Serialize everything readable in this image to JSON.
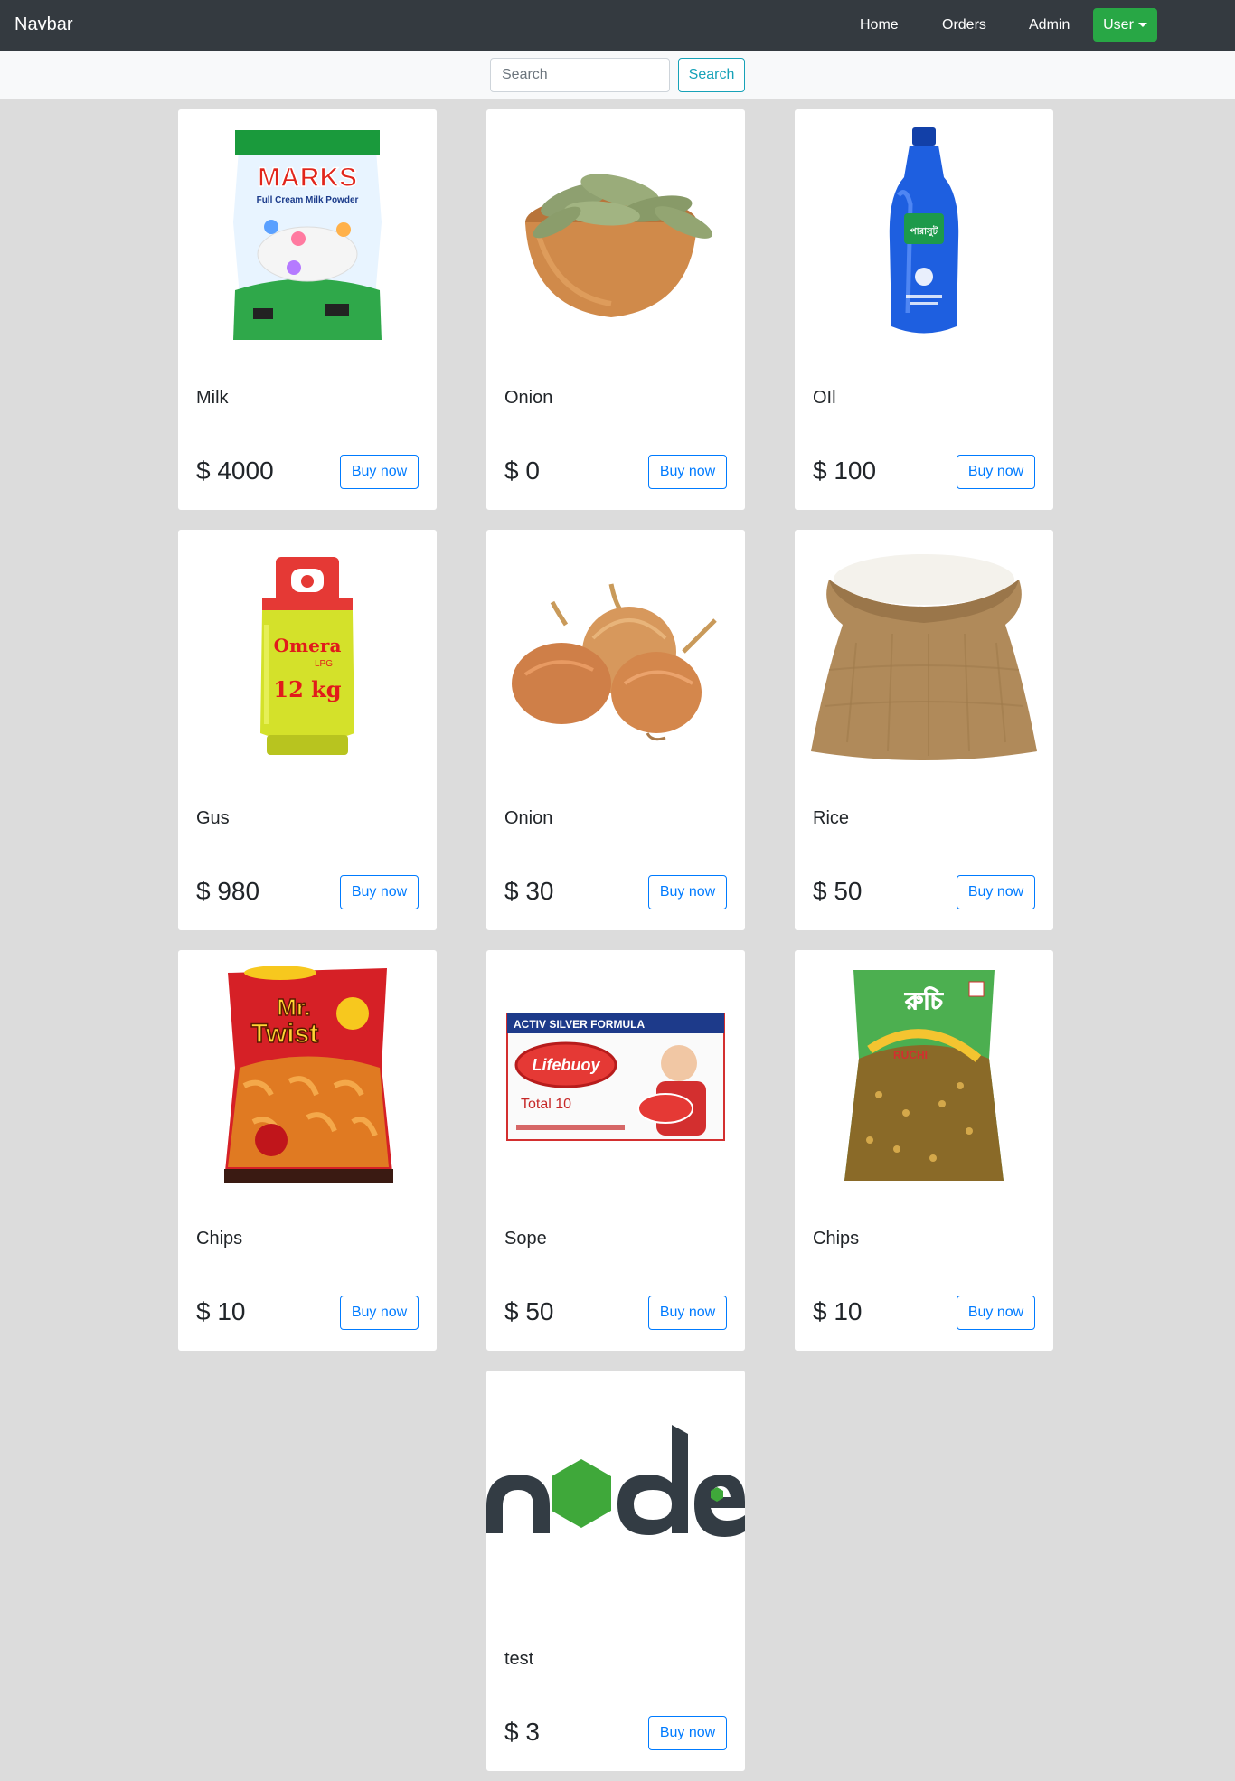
{
  "navbar": {
    "brand": "Navbar",
    "links": [
      "Home",
      "Orders",
      "Admin"
    ],
    "user_label": "User"
  },
  "search": {
    "placeholder": "Search",
    "button_label": "Search"
  },
  "products": [
    {
      "title": "Milk",
      "price": "$ 4000",
      "button": "Buy now",
      "image": "milk-powder-packet-image",
      "image_text": "MARKS",
      "image_sub": "Full Cream Milk Powder"
    },
    {
      "title": "Onion",
      "price": "$ 0",
      "button": "Buy now",
      "image": "bay-leaves-bowl-image"
    },
    {
      "title": "OIl",
      "price": "$ 100",
      "button": "Buy now",
      "image": "oil-bottle-image",
      "image_text": "পারাসুট"
    },
    {
      "title": "Gus",
      "price": "$ 980",
      "button": "Buy now",
      "image": "gas-cylinder-image",
      "image_text": "Omera",
      "image_sub": "LPG",
      "image_sub2": "12 kg"
    },
    {
      "title": "Onion",
      "price": "$ 30",
      "button": "Buy now",
      "image": "onions-image"
    },
    {
      "title": "Rice",
      "price": "$ 50",
      "button": "Buy now",
      "image": "rice-sack-image"
    },
    {
      "title": "Chips",
      "price": "$ 10",
      "button": "Buy now",
      "image": "mr-twist-chips-image",
      "image_text": "Mr.",
      "image_sub": "Twist"
    },
    {
      "title": "Sope",
      "price": "$ 50",
      "button": "Buy now",
      "image": "lifebuoy-soap-image",
      "image_text": "ACTIV SILVER FORMULA",
      "image_sub": "Lifebuoy",
      "image_sub2": "Total 10"
    },
    {
      "title": "Chips",
      "price": "$ 10",
      "button": "Buy now",
      "image": "ruchi-chanachur-image",
      "image_text": "রুচি",
      "image_sub": "RUCHI"
    },
    {
      "title": "test",
      "price": "$ 3",
      "button": "Buy now",
      "image": "node-logo-image",
      "image_text": "node"
    }
  ],
  "colors": {
    "navbar_bg": "#343a40",
    "user_button": "#28a745",
    "search_button": "#17a2b8",
    "buy_button": "#007bff",
    "page_bg": "#dcdcdc"
  }
}
